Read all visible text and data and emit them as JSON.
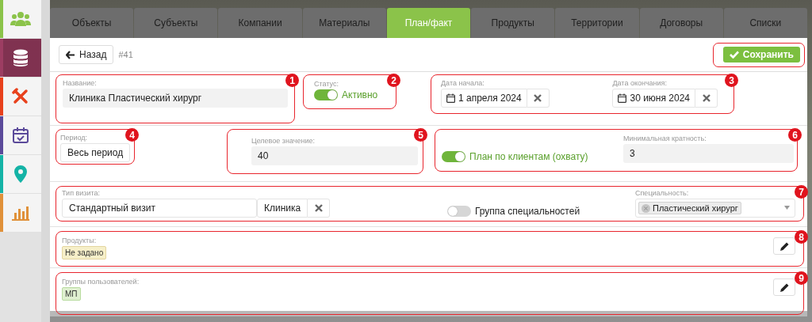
{
  "sidebar": {
    "items": [
      {
        "color": "#8bc34a",
        "selected": false
      },
      {
        "color": "#9c3d62",
        "selected": true
      },
      {
        "color": "#e8411c",
        "selected": false
      },
      {
        "color": "#5b4a9a",
        "selected": false
      },
      {
        "color": "#14b3a6",
        "selected": false
      },
      {
        "color": "#e0913a",
        "selected": false
      }
    ]
  },
  "tabs": [
    {
      "label": "Объекты",
      "selected": false
    },
    {
      "label": "Субъекты",
      "selected": false
    },
    {
      "label": "Компании",
      "selected": false
    },
    {
      "label": "Материалы",
      "selected": false
    },
    {
      "label": "План/факт",
      "selected": true
    },
    {
      "label": "Продукты",
      "selected": false
    },
    {
      "label": "Территории",
      "selected": false
    },
    {
      "label": "Договоры",
      "selected": false
    },
    {
      "label": "Списки",
      "selected": false
    }
  ],
  "toolbar": {
    "back_button": "Назад",
    "record_id": "#41",
    "save_button": "Сохранить"
  },
  "form": {
    "name": {
      "callout": "1",
      "label": "Название:",
      "value": "Клиника Пластический хирург"
    },
    "status": {
      "callout": "2",
      "label": "Статус:",
      "on": true,
      "text": "Активно"
    },
    "dates": {
      "callout": "3",
      "start": {
        "label": "Дата начала:",
        "value": "1 апреля 2024"
      },
      "end": {
        "label": "Дата окончания:",
        "value": "30 июня 2024"
      }
    },
    "period": {
      "callout": "4",
      "label": "Период:",
      "value": "Весь период"
    },
    "target": {
      "callout": "5",
      "label": "Целевое значение:",
      "value": "40"
    },
    "client_plan": {
      "callout": "6",
      "toggle_label": "План по клиентам (охвату)",
      "on": true,
      "min_multiplicity": {
        "label": "Минимальная кратность:",
        "value": "3"
      }
    },
    "visit": {
      "callout": "7",
      "type_label": "Тип визита:",
      "type_value": "Стандартный визит",
      "place_value": "Клиника",
      "specialty_group": {
        "label": "Группа специальностей",
        "on": false
      },
      "specialty": {
        "label": "Специальность:",
        "tags": [
          "Пластический хирург"
        ]
      }
    },
    "products": {
      "callout": "8",
      "label": "Продукты:",
      "tags": [
        {
          "text": "Не задано",
          "kind": "empty"
        }
      ]
    },
    "user_groups": {
      "callout": "9",
      "label": "Группы пользователей:",
      "tags": [
        {
          "text": "МП",
          "kind": "group"
        }
      ]
    }
  }
}
